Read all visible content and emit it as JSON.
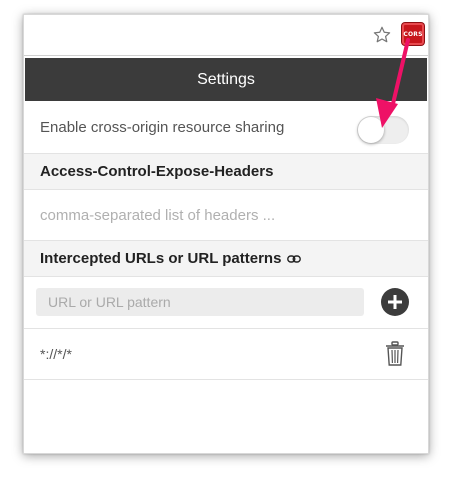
{
  "toolbar": {
    "bookmark_icon": "star-icon",
    "extension_badge_label": "CORS",
    "extension_color": "#c7161c"
  },
  "header": {
    "title": "Settings",
    "background": "#3b3b3b"
  },
  "settings": {
    "enable_label": "Enable cross-origin resource sharing",
    "enable_toggle": "off"
  },
  "expose_headers": {
    "title": "Access-Control-Expose-Headers",
    "placeholder": "comma-separated list of headers ..."
  },
  "intercepted": {
    "title": "Intercepted URLs or URL patterns",
    "title_icon": "link-icon",
    "input_placeholder": "URL or URL pattern",
    "add_icon": "plus-icon",
    "patterns": [
      {
        "value": "*://*/*",
        "delete_icon": "trash-icon"
      }
    ]
  },
  "annotation": {
    "arrow_color": "#ee1166"
  }
}
